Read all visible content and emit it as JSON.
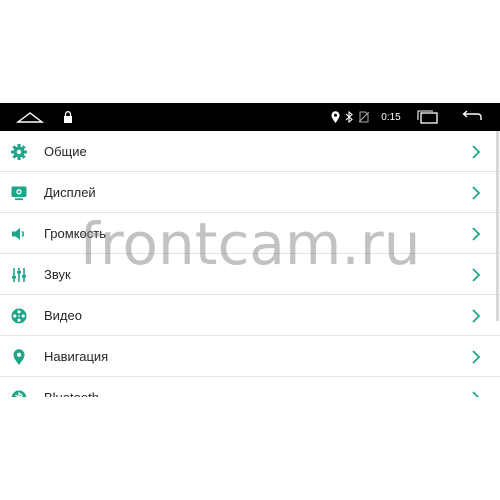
{
  "colors": {
    "accent": "#1fa58a",
    "statusbar": "#000000",
    "text": "#262626",
    "chevron": "#1fa58a"
  },
  "statusbar": {
    "time": "0:15",
    "icons": [
      "home-icon",
      "lock-icon",
      "location-icon",
      "bluetooth-icon",
      "no-sim-icon",
      "recent-apps-icon",
      "back-icon"
    ]
  },
  "menu": {
    "items": [
      {
        "label": "Общие",
        "icon": "gear-icon"
      },
      {
        "label": "Дисплей",
        "icon": "display-icon"
      },
      {
        "label": "Громкость",
        "icon": "volume-icon"
      },
      {
        "label": "Звук",
        "icon": "equalizer-icon"
      },
      {
        "label": "Видео",
        "icon": "video-reel-icon"
      },
      {
        "label": "Навигация",
        "icon": "navigation-pin-icon"
      },
      {
        "label": "Bluetooth",
        "icon": "bluetooth-icon"
      }
    ]
  },
  "watermark": "frontcam.ru"
}
